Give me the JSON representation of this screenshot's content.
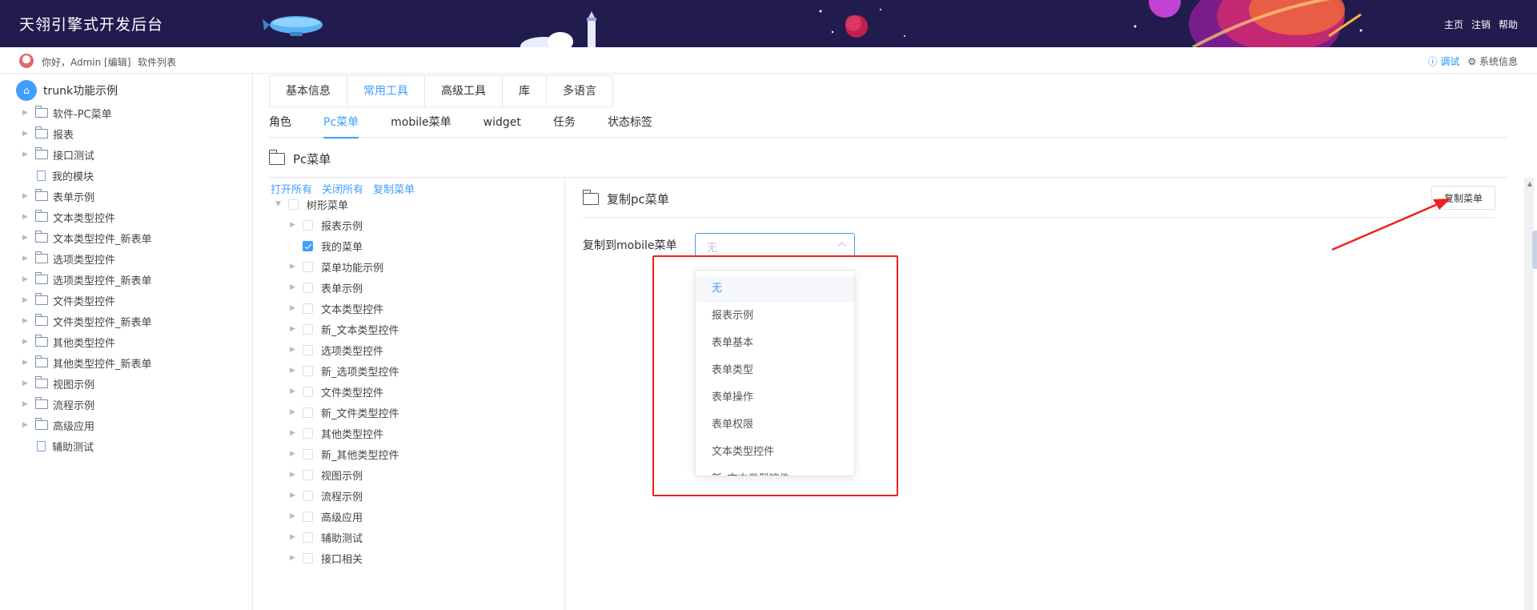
{
  "header": {
    "title": "天翎引擎式开发后台",
    "links": [
      "主页",
      "注销",
      "帮助"
    ]
  },
  "userbar": {
    "greeting": "你好，Admin [编辑]",
    "software_list": "软件列表",
    "debug": "ⓘ 调试",
    "system_info": "⚙ 系统信息"
  },
  "left_tree": {
    "root": "trunk功能示例",
    "items": [
      {
        "label": "软件-PC菜单",
        "type": "folder"
      },
      {
        "label": "报表",
        "type": "folder"
      },
      {
        "label": "接口测试",
        "type": "folder"
      },
      {
        "label": "我的模块",
        "type": "doc"
      },
      {
        "label": "表单示例",
        "type": "folder"
      },
      {
        "label": "文本类型控件",
        "type": "folder"
      },
      {
        "label": "文本类型控件_新表单",
        "type": "folder"
      },
      {
        "label": "选项类型控件",
        "type": "folder"
      },
      {
        "label": "选项类型控件_新表单",
        "type": "folder"
      },
      {
        "label": "文件类型控件",
        "type": "folder"
      },
      {
        "label": "文件类型控件_新表单",
        "type": "folder"
      },
      {
        "label": "其他类型控件",
        "type": "folder"
      },
      {
        "label": "其他类型控件_新表单",
        "type": "folder"
      },
      {
        "label": "视图示例",
        "type": "folder"
      },
      {
        "label": "流程示例",
        "type": "folder"
      },
      {
        "label": "高级应用",
        "type": "folder"
      },
      {
        "label": "辅助测试",
        "type": "doc"
      }
    ]
  },
  "tabs_primary": [
    "基本信息",
    "常用工具",
    "高级工具",
    "库",
    "多语言"
  ],
  "tabs_primary_active": 1,
  "tabs_secondary": [
    "角色",
    "Pc菜单",
    "mobile菜单",
    "widget",
    "任务",
    "状态标签"
  ],
  "tabs_secondary_active": 1,
  "section_title": "Pc菜单",
  "tree_actions": [
    "打开所有",
    "关闭所有",
    "复制菜单"
  ],
  "menu_tree": {
    "root": "树形菜单",
    "items": [
      {
        "label": "报表示例",
        "checked": false
      },
      {
        "label": "我的菜单",
        "checked": true
      },
      {
        "label": "菜单功能示例",
        "checked": false
      },
      {
        "label": "表单示例",
        "checked": false
      },
      {
        "label": "文本类型控件",
        "checked": false
      },
      {
        "label": "新_文本类型控件",
        "checked": false
      },
      {
        "label": "选项类型控件",
        "checked": false
      },
      {
        "label": "新_选项类型控件",
        "checked": false
      },
      {
        "label": "文件类型控件",
        "checked": false
      },
      {
        "label": "新_文件类型控件",
        "checked": false
      },
      {
        "label": "其他类型控件",
        "checked": false
      },
      {
        "label": "新_其他类型控件",
        "checked": false
      },
      {
        "label": "视图示例",
        "checked": false
      },
      {
        "label": "流程示例",
        "checked": false
      },
      {
        "label": "高级应用",
        "checked": false
      },
      {
        "label": "辅助测试",
        "checked": false
      },
      {
        "label": "接口相关",
        "checked": false
      }
    ]
  },
  "copy_panel": {
    "title": "复制pc菜单",
    "button": "复制菜单",
    "field_label": "复制到mobile菜单",
    "select_value": "无",
    "options": [
      "无",
      "报表示例",
      "表单基本",
      "表单类型",
      "表单操作",
      "表单权限",
      "文本类型控件",
      "新_文本类型控件"
    ],
    "selected_index": 0
  },
  "colors": {
    "accent": "#409eff",
    "banner": "#221b4d",
    "highlight": "#f02020"
  }
}
